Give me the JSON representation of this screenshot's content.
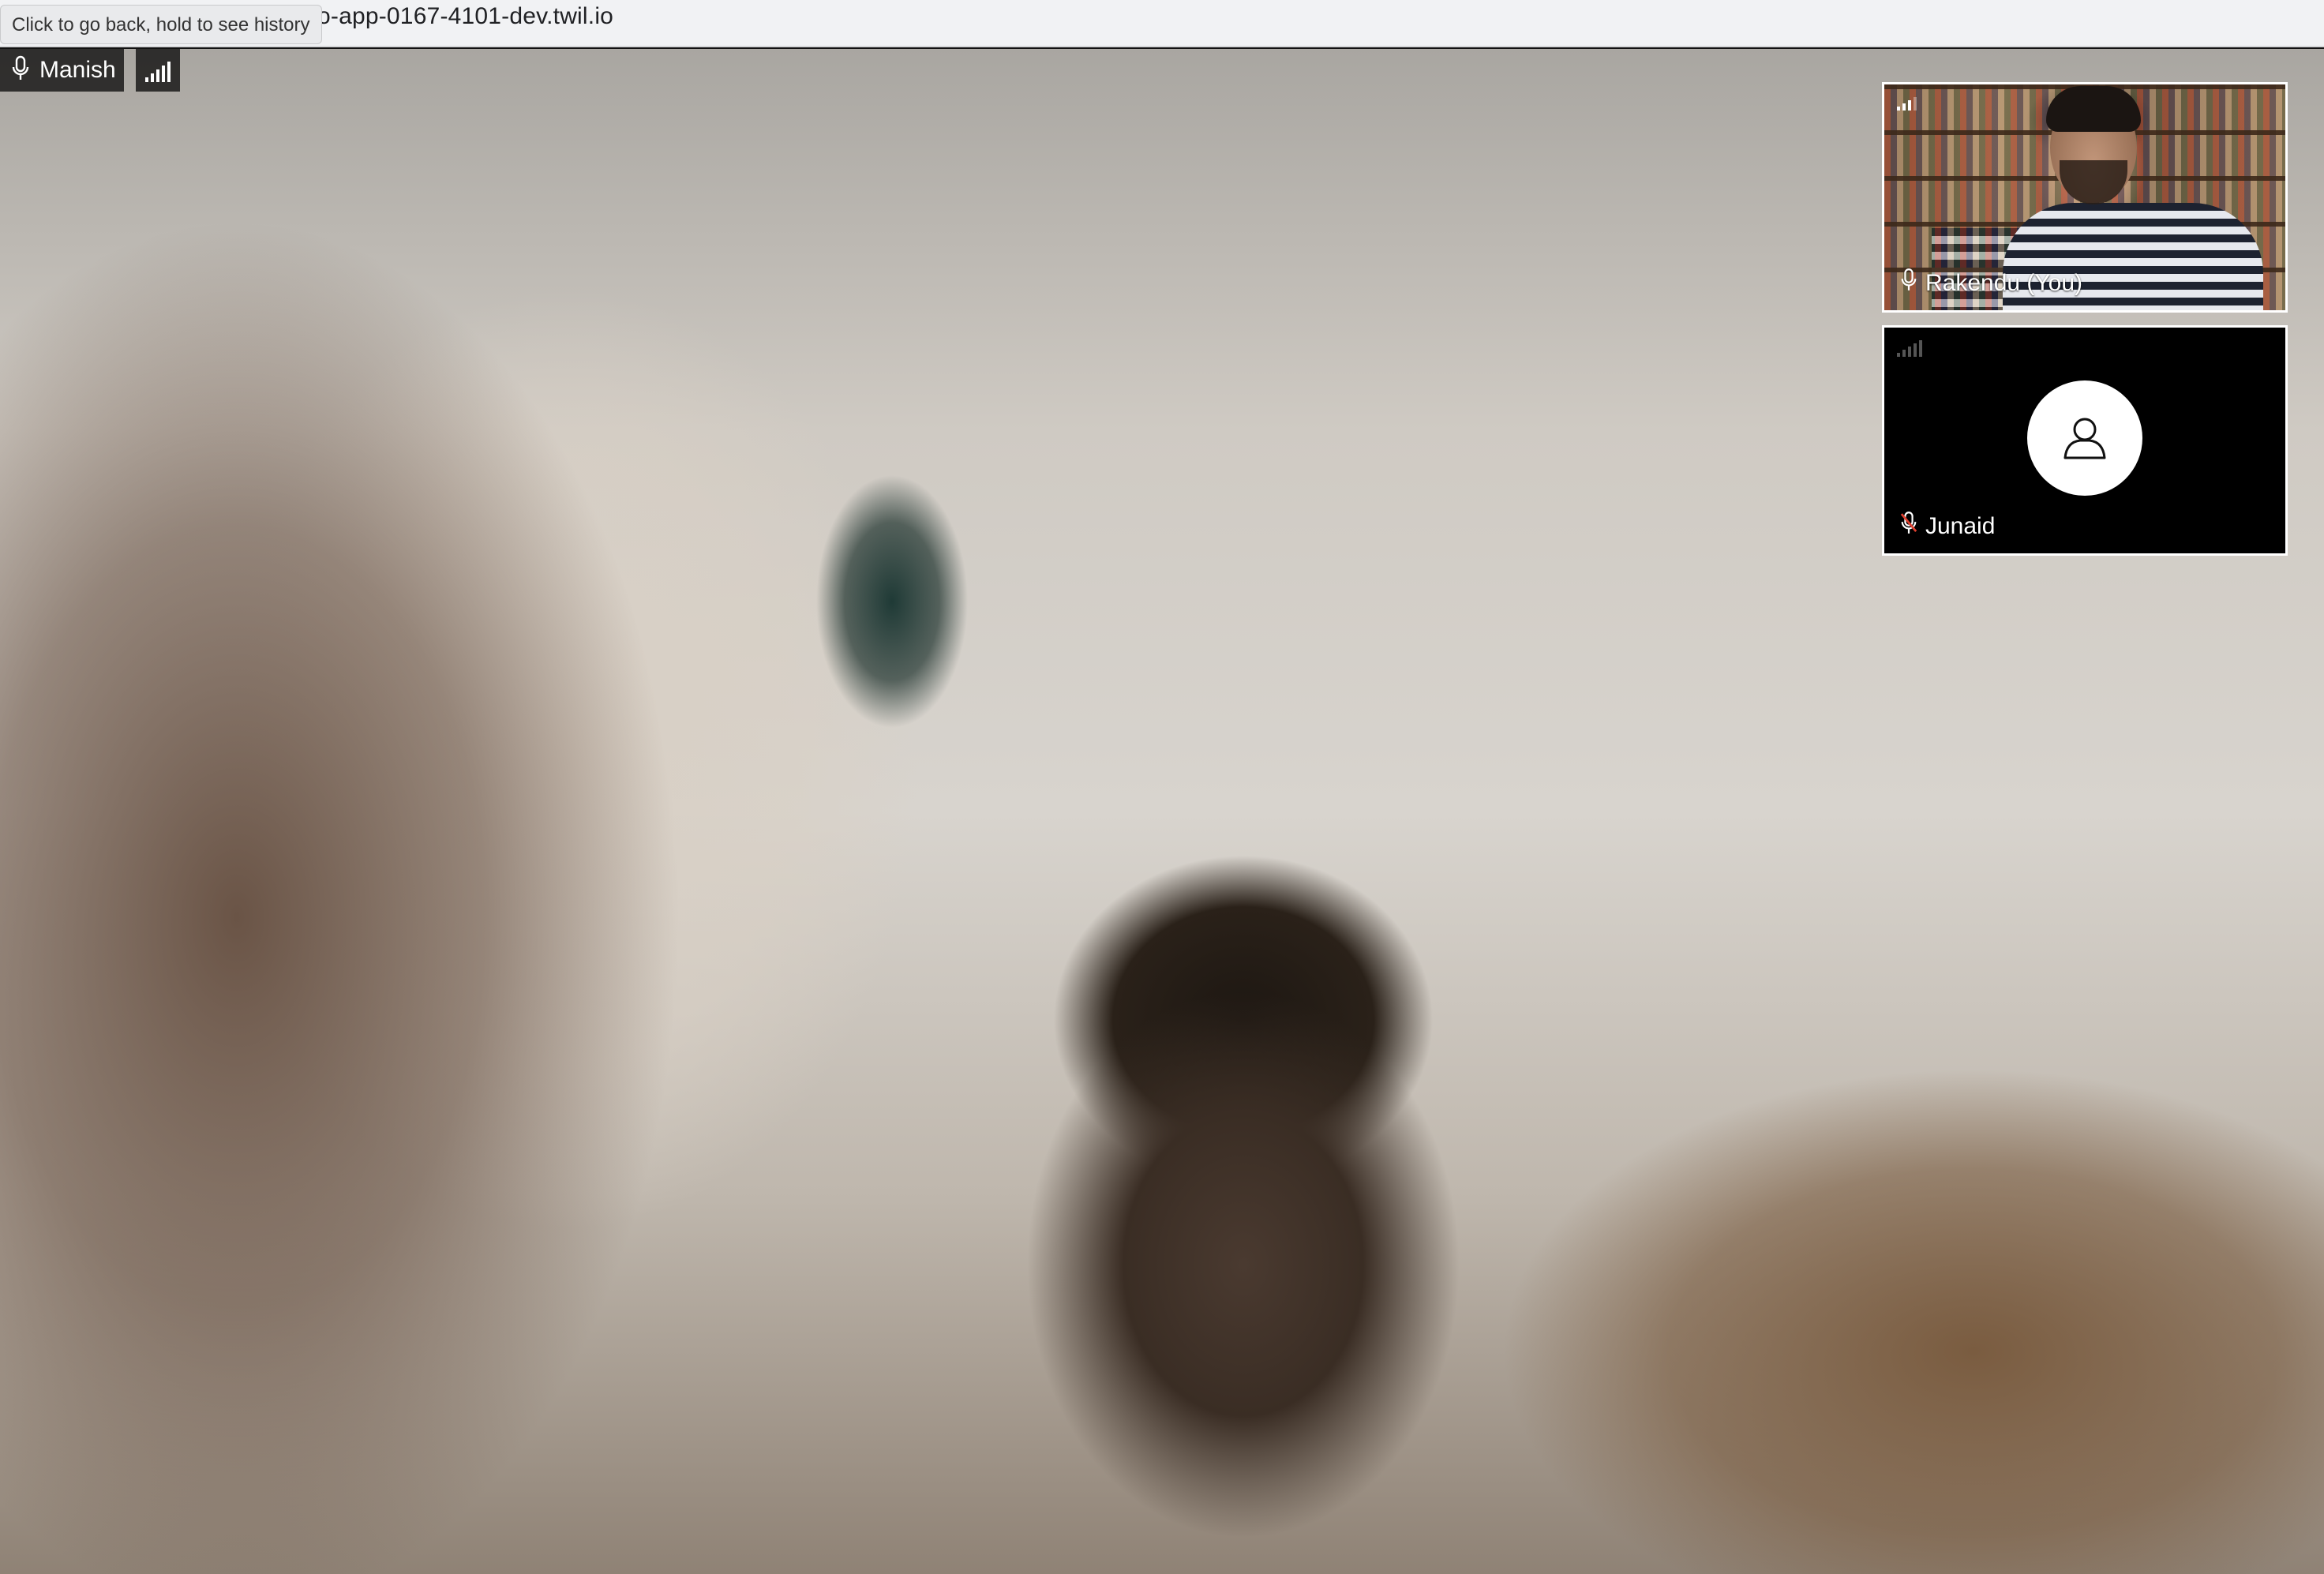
{
  "browser": {
    "url": "video-app-0167-4101-dev.twil.io",
    "url_visible": "o-app-0167-4101-dev.twil.io",
    "back_tooltip": "Click to go back, hold to see history"
  },
  "main_participant": {
    "name": "Manish",
    "mic_icon": "mic-icon",
    "signal_icon": "signal-bars-icon"
  },
  "participants": [
    {
      "name": "Rakendu (You)",
      "mic_icon": "mic-icon",
      "signal_icon": "signal-bars-icon",
      "video": "on"
    },
    {
      "name": "Junaid",
      "mic_icon": "mic-muted-icon",
      "signal_icon": "signal-bars-icon",
      "video": "off",
      "avatar_icon": "user-avatar-icon"
    }
  ],
  "colors": {
    "tile_border": "#ffffff",
    "badge_bg": "rgba(0,0,0,0.72)",
    "muted_mic": "#e0402f"
  }
}
